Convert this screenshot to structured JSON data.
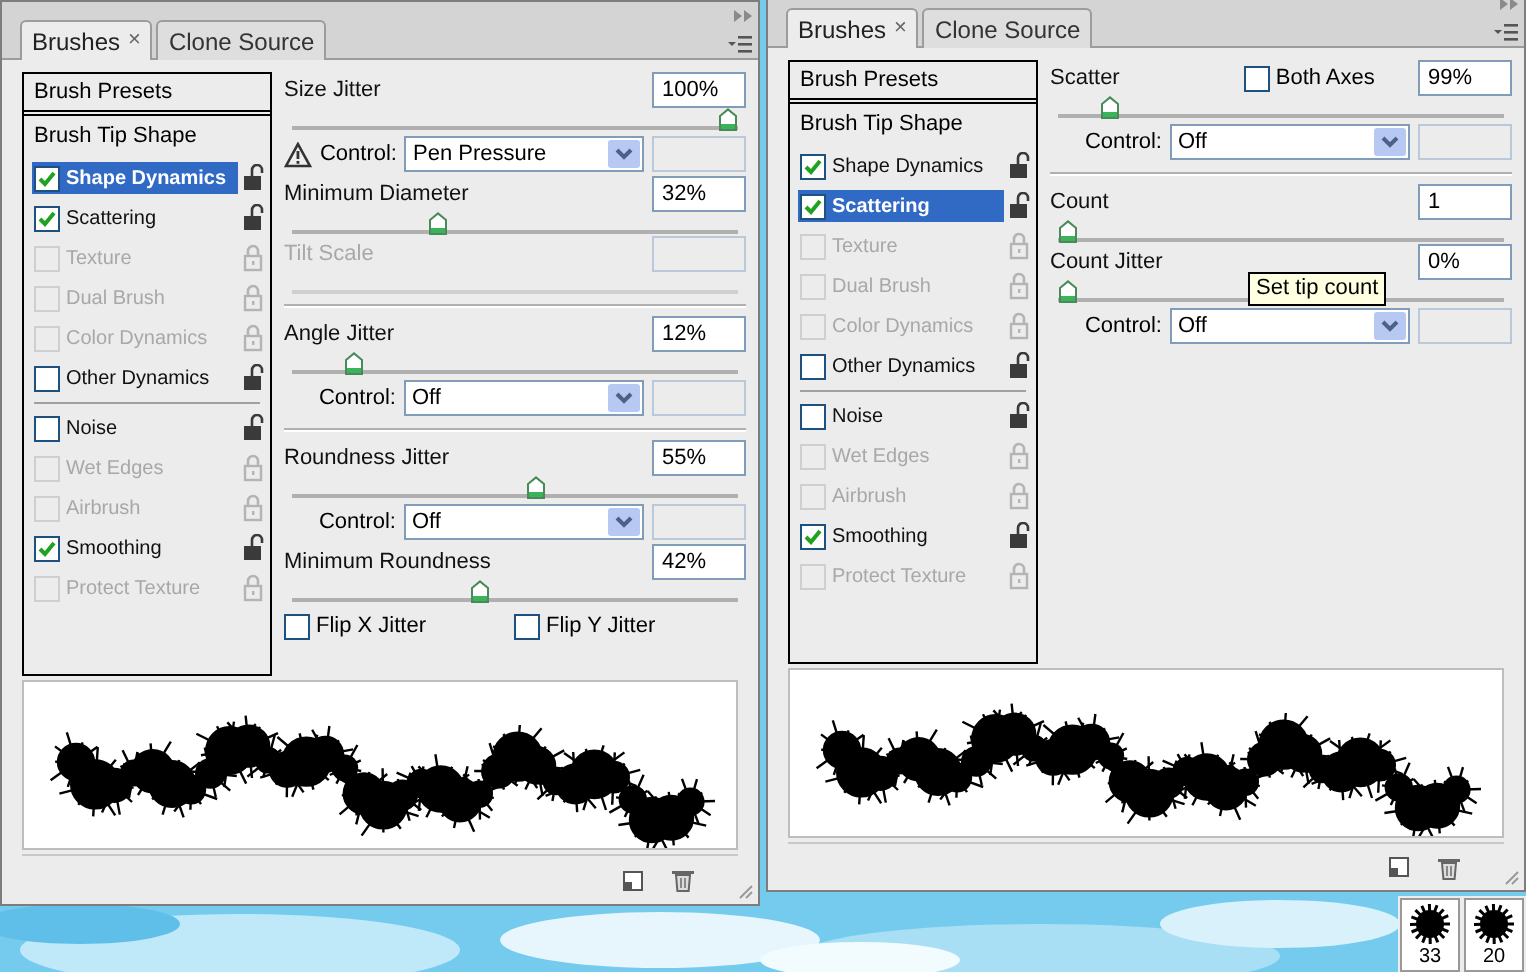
{
  "panels": [
    {
      "tabs": [
        {
          "label": "Brushes",
          "close": "×",
          "selected": true
        },
        {
          "label": "Clone Source",
          "selected": false
        }
      ],
      "sidebar": {
        "presets": "Brush Presets",
        "tip_shape": {
          "label": "Brush Tip Shape",
          "selected": false
        },
        "groups": [
          [
            {
              "label": "Shape Dynamics",
              "checked": true,
              "disabled": false,
              "selected": true
            },
            {
              "label": "Scattering",
              "checked": true,
              "disabled": false,
              "selected": false
            },
            {
              "label": "Texture",
              "checked": false,
              "disabled": true,
              "selected": false
            },
            {
              "label": "Dual Brush",
              "checked": false,
              "disabled": true,
              "selected": false
            },
            {
              "label": "Color Dynamics",
              "checked": false,
              "disabled": true,
              "selected": false
            },
            {
              "label": "Other Dynamics",
              "checked": false,
              "disabled": false,
              "selected": false
            }
          ],
          [
            {
              "label": "Noise",
              "checked": false,
              "disabled": false,
              "selected": false
            },
            {
              "label": "Wet Edges",
              "checked": false,
              "disabled": true,
              "selected": false
            },
            {
              "label": "Airbrush",
              "checked": false,
              "disabled": true,
              "selected": false
            },
            {
              "label": "Smoothing",
              "checked": true,
              "disabled": false,
              "selected": false
            },
            {
              "label": "Protect Texture",
              "checked": false,
              "disabled": true,
              "selected": false
            }
          ]
        ]
      },
      "settings": [
        {
          "kind": "slider",
          "label": "Size Jitter",
          "value": "100%",
          "level": 1,
          "disabled": false
        },
        {
          "kind": "control",
          "label": "Control:",
          "value": "Pen Pressure",
          "warning": true
        },
        {
          "kind": "slider",
          "label": "Minimum Diameter",
          "value": "32%",
          "level": 0.32,
          "disabled": false
        },
        {
          "kind": "slider",
          "label": "Tilt Scale",
          "disabled": true
        },
        {
          "kind": "divider"
        },
        {
          "kind": "slider",
          "label": "Angle Jitter",
          "value": "12%",
          "level": 0.12,
          "disabled": false
        },
        {
          "kind": "control",
          "label": "Control:",
          "value": "Off",
          "warning": false
        },
        {
          "kind": "divider"
        },
        {
          "kind": "slider",
          "label": "Roundness Jitter",
          "value": "55%",
          "level": 0.55,
          "disabled": false
        },
        {
          "kind": "control",
          "label": "Control:",
          "value": "Off",
          "warning": false
        },
        {
          "kind": "slider",
          "label": "Minimum Roundness",
          "value": "42%",
          "level": 0.42,
          "disabled": false
        },
        {
          "kind": "checks",
          "items": [
            {
              "label": "Flip X Jitter",
              "checked": false
            },
            {
              "label": "Flip Y Jitter",
              "checked": false
            }
          ]
        }
      ]
    },
    {
      "tabs": [
        {
          "label": "Brushes",
          "close": "×",
          "selected": true
        },
        {
          "label": "Clone Source",
          "selected": false
        }
      ],
      "sidebar": {
        "presets": "Brush Presets",
        "tip_shape": {
          "label": "Brush Tip Shape",
          "selected": false
        },
        "groups": [
          [
            {
              "label": "Shape Dynamics",
              "checked": true,
              "disabled": false,
              "selected": false
            },
            {
              "label": "Scattering",
              "checked": true,
              "disabled": false,
              "selected": true
            },
            {
              "label": "Texture",
              "checked": false,
              "disabled": true,
              "selected": false
            },
            {
              "label": "Dual Brush",
              "checked": false,
              "disabled": true,
              "selected": false
            },
            {
              "label": "Color Dynamics",
              "checked": false,
              "disabled": true,
              "selected": false
            },
            {
              "label": "Other Dynamics",
              "checked": false,
              "disabled": false,
              "selected": false
            }
          ],
          [
            {
              "label": "Noise",
              "checked": false,
              "disabled": false,
              "selected": false
            },
            {
              "label": "Wet Edges",
              "checked": false,
              "disabled": true,
              "selected": false
            },
            {
              "label": "Airbrush",
              "checked": false,
              "disabled": true,
              "selected": false
            },
            {
              "label": "Smoothing",
              "checked": true,
              "disabled": false,
              "selected": false
            },
            {
              "label": "Protect Texture",
              "checked": false,
              "disabled": true,
              "selected": false
            }
          ]
        ]
      },
      "settings": [
        {
          "kind": "slider",
          "label": "Scatter",
          "value": "99%",
          "level": 0.1,
          "disabled": false,
          "option": {
            "label": "Both Axes",
            "checked": false
          }
        },
        {
          "kind": "control",
          "label": "Control:",
          "value": "Off",
          "warning": false
        },
        {
          "kind": "divider"
        },
        {
          "kind": "slider",
          "label": "Count",
          "value": "1",
          "level": 0,
          "disabled": false
        },
        {
          "kind": "slider",
          "label": "Count Jitter",
          "value": "0%",
          "level": 0,
          "disabled": false
        },
        {
          "kind": "control",
          "label": "Control:",
          "value": "Off",
          "warning": false
        }
      ],
      "tooltip": "Set tip count"
    }
  ],
  "brush_thumbnails": [
    {
      "size": "33"
    },
    {
      "size": "20"
    }
  ]
}
